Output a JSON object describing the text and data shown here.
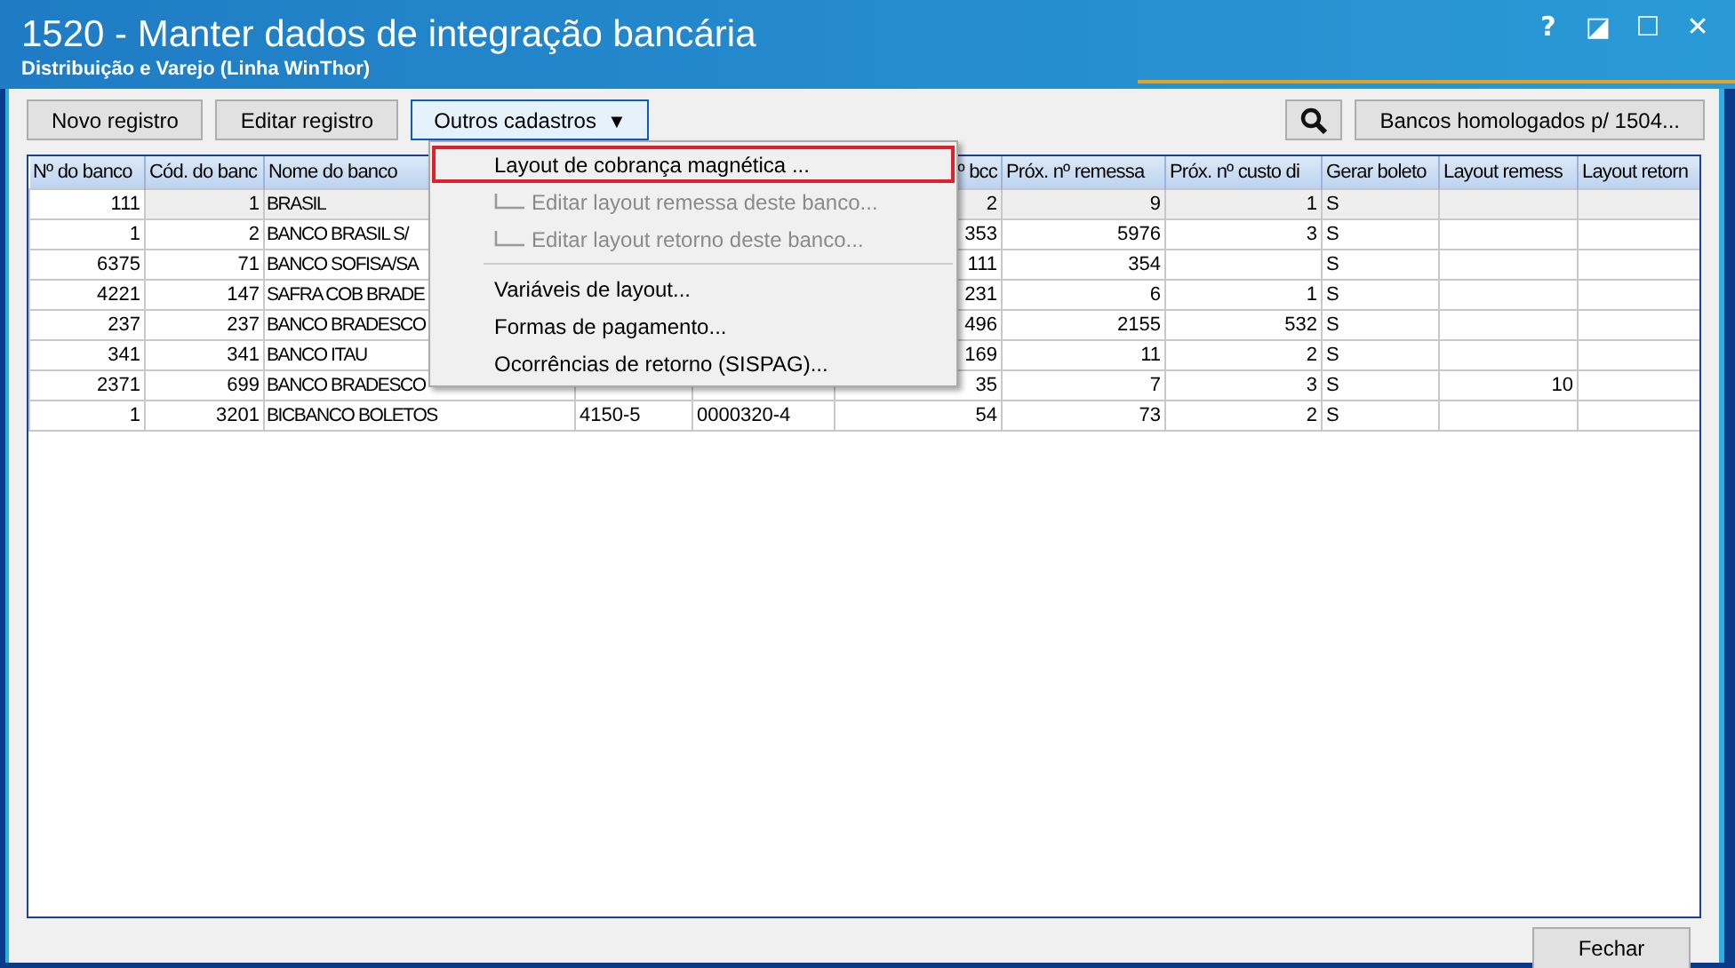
{
  "window": {
    "title": "1520 - Manter dados de integração bancária",
    "subtitle": "Distribuição e Varejo (Linha WinThor)",
    "controls": [
      "?",
      "◪",
      "☐",
      "✕"
    ]
  },
  "toolbar": {
    "buttons": [
      {
        "label": "Novo registro",
        "kind": "plain"
      },
      {
        "label": "Editar registro",
        "kind": "plain"
      },
      {
        "label": "Outros cadastros",
        "kind": "dropdown",
        "caret": "▼"
      }
    ],
    "right_buttons": [
      {
        "kind": "search"
      },
      {
        "label": "Bancos homologados p/ 1504...",
        "kind": "plain"
      }
    ]
  },
  "table": {
    "columns": [
      "Nº do banco",
      "Cód. do banc",
      "Nome do banco",
      null,
      null,
      "º bcc",
      "Próx. nº remessa",
      "Próx. nº custo di",
      "Gerar boleto",
      "Layout remess",
      "Layout retorn"
    ],
    "rows": [
      {
        "selected": true,
        "cells": [
          "111",
          "1",
          "BRASIL",
          null,
          null,
          "2",
          "9",
          "1",
          "S",
          null,
          null
        ]
      },
      {
        "selected": false,
        "cells": [
          "1",
          "2",
          "BANCO BRASIL S/",
          null,
          null,
          "353",
          "5976",
          "3",
          "S",
          null,
          null
        ]
      },
      {
        "selected": false,
        "cells": [
          "6375",
          "71",
          "BANCO SOFISA/SA",
          null,
          null,
          "111",
          "354",
          null,
          "S",
          null,
          null
        ]
      },
      {
        "selected": false,
        "cells": [
          "4221",
          "147",
          "SAFRA COB BRADE",
          null,
          null,
          "231",
          "6",
          "1",
          "S",
          null,
          null
        ]
      },
      {
        "selected": false,
        "cells": [
          "237",
          "237",
          "BANCO BRADESCO",
          null,
          null,
          "496",
          "2155",
          "532",
          "S",
          null,
          null
        ]
      },
      {
        "selected": false,
        "cells": [
          "341",
          "341",
          "BANCO ITAU",
          null,
          null,
          "169",
          "11",
          "2",
          "S",
          null,
          null
        ]
      },
      {
        "selected": false,
        "cells": [
          "2371",
          "699",
          "BANCO BRADESCO",
          null,
          null,
          "35",
          "7",
          "3",
          "S",
          "10",
          null
        ]
      },
      {
        "selected": false,
        "cells": [
          "1",
          "3201",
          "BICBANCO BOLETOS",
          "4150-5",
          "0000320-4",
          "54",
          "73",
          "2",
          "S",
          null,
          null
        ]
      }
    ]
  },
  "menu": {
    "items": [
      {
        "kind": "item",
        "label": "Layout de cobrança magnética ...",
        "selected": true,
        "disabled": false
      },
      {
        "kind": "subitem",
        "label": "Editar layout remessa deste banco...",
        "selected": false,
        "disabled": true
      },
      {
        "kind": "subitem",
        "label": "Editar layout retorno deste banco...",
        "selected": false,
        "disabled": true
      },
      {
        "kind": "separator"
      },
      {
        "kind": "item",
        "label": "Variáveis de layout...",
        "selected": false,
        "disabled": false
      },
      {
        "kind": "item",
        "label": "Formas de pagamento...",
        "selected": false,
        "disabled": false
      },
      {
        "kind": "item",
        "label": "Ocorrências de retorno (SISPAG)...",
        "selected": false,
        "disabled": false
      }
    ]
  },
  "footer": {
    "buttons": [
      "Fechar"
    ]
  }
}
